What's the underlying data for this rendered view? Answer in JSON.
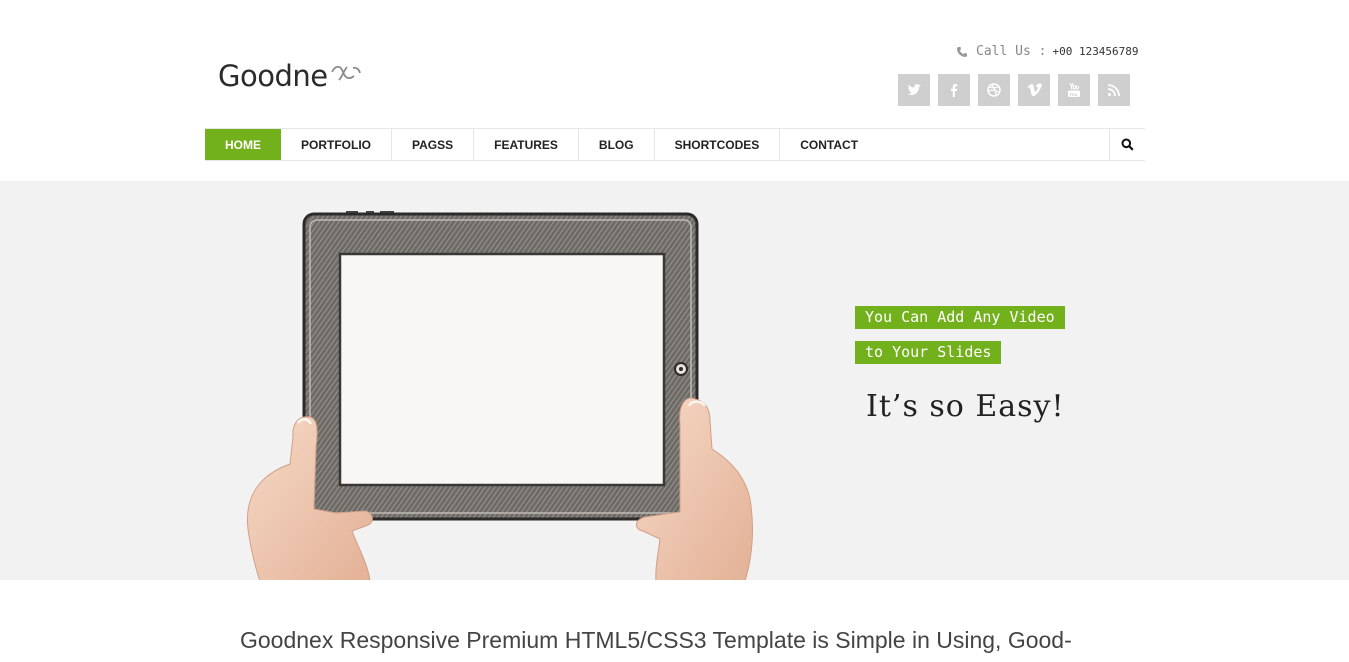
{
  "header": {
    "logo_text": "Goodne",
    "call_label": "Call Us :",
    "call_number": "+00 123456789",
    "social": [
      {
        "icon": "twitter-icon"
      },
      {
        "icon": "facebook-icon"
      },
      {
        "icon": "dribbble-icon"
      },
      {
        "icon": "vimeo-icon"
      },
      {
        "icon": "youtube-icon"
      },
      {
        "icon": "rss-icon"
      }
    ]
  },
  "nav": {
    "items": [
      {
        "label": "HOME",
        "active": true
      },
      {
        "label": "PORTFOLIO"
      },
      {
        "label": "PAGSS"
      },
      {
        "label": "FEATURES"
      },
      {
        "label": "BLOG"
      },
      {
        "label": "SHORTCODES"
      },
      {
        "label": "CONTACT"
      }
    ],
    "search_icon": "search-icon"
  },
  "slider": {
    "caption_line1": "You Can Add Any Video",
    "caption_line2": "to Your Slides",
    "tagline": "It’s so Easy!"
  },
  "intro": {
    "text": "Goodnex Responsive Premium HTML5/CSS3 Template is Simple in Using, Good-"
  },
  "colors": {
    "accent": "#72b01c",
    "hero_bg": "#f2f2f2",
    "social_bg": "#cfcfcf"
  }
}
